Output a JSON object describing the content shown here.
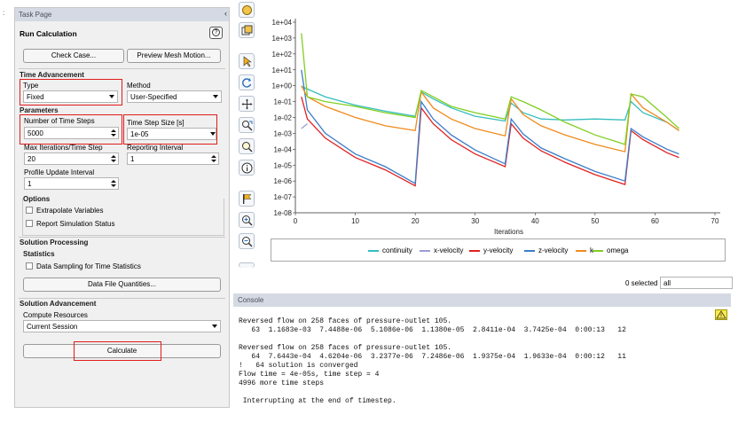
{
  "task_page": {
    "header": "Task Page",
    "title": "Run Calculation",
    "help_glyph": "?",
    "check_case_label": "Check Case...",
    "preview_mesh_label": "Preview Mesh Motion...",
    "time_advancement_label": "Time Advancement",
    "type_label": "Type",
    "type_value": "Fixed",
    "method_label": "Method",
    "method_value": "User-Specified",
    "parameters_label": "Parameters",
    "num_steps_label": "Number of Time Steps",
    "num_steps_value": "5000",
    "step_size_label": "Time Step Size [s]",
    "step_size_value": "1e-05",
    "max_iter_label": "Max Iterations/Time Step",
    "max_iter_value": "20",
    "reporting_label": "Reporting Interval",
    "reporting_value": "1",
    "profile_label": "Profile Update Interval",
    "profile_value": "1",
    "options_label": "Options",
    "extrapolate_label": "Extrapolate Variables",
    "report_status_label": "Report Simulation Status",
    "solution_processing_label": "Solution Processing",
    "statistics_label": "Statistics",
    "data_sampling_label": "Data Sampling for Time Statistics",
    "data_file_label": "Data File Quantities...",
    "solution_advancement_label": "Solution Advancement",
    "compute_resources_label": "Compute Resources",
    "compute_value": "Current Session",
    "calculate_label": "Calculate"
  },
  "chart_data": {
    "type": "line",
    "xlabel": "Iterations",
    "ylabel": "",
    "title": "",
    "xlim": [
      0,
      70
    ],
    "yscale": "log",
    "ylim": [
      1e-08,
      10000
    ],
    "x_ticks": [
      "0",
      "10",
      "20",
      "30",
      "40",
      "50",
      "60",
      "70"
    ],
    "y_ticks": [
      "1e-08",
      "1e-07",
      "1e-06",
      "1e-05",
      "1e-04",
      "1e-03",
      "1e-02",
      "1e-01",
      "1e+00",
      "1e+01",
      "1e+02",
      "1e+03",
      "1e+04"
    ],
    "series": [
      {
        "name": "continuity",
        "color": "#35bdbd",
        "x": [
          1,
          5,
          10,
          15,
          20,
          21,
          23,
          26,
          30,
          35,
          36,
          38,
          41,
          45,
          50,
          55,
          56,
          58,
          62,
          64
        ],
        "y": [
          0.9,
          0.2,
          0.06,
          0.025,
          0.012,
          0.4,
          0.15,
          0.04,
          0.012,
          0.006,
          0.08,
          0.02,
          0.008,
          0.007,
          0.008,
          0.007,
          0.1,
          0.02,
          0.005,
          0.0015
        ]
      },
      {
        "name": "x-velocity",
        "color": "#9b9bd6",
        "x": [
          1,
          2
        ],
        "y": [
          0.002,
          0.004
        ]
      },
      {
        "name": "y-velocity",
        "color": "#e02020",
        "x": [
          1,
          2,
          5,
          10,
          15,
          20,
          21,
          23,
          26,
          30,
          35,
          36,
          38,
          41,
          45,
          50,
          55,
          56,
          58,
          62,
          64
        ],
        "y": [
          0.2,
          0.008,
          0.0005,
          3e-05,
          5e-06,
          5e-07,
          0.04,
          0.004,
          0.0004,
          5e-05,
          8e-06,
          0.004,
          0.0005,
          8e-05,
          1.5e-05,
          2.5e-06,
          6e-07,
          0.0015,
          0.0004,
          6e-05,
          3e-05
        ]
      },
      {
        "name": "z-velocity",
        "color": "#3a7dc9",
        "x": [
          1,
          2,
          5,
          10,
          15,
          20,
          21,
          23,
          26,
          30,
          35,
          36,
          38,
          41,
          45,
          50,
          55,
          56,
          58,
          62,
          64
        ],
        "y": [
          10,
          0.03,
          0.001,
          5e-05,
          8e-06,
          7e-07,
          0.1,
          0.008,
          0.0008,
          9e-05,
          1.2e-05,
          0.008,
          0.0009,
          0.00012,
          2.5e-05,
          4e-06,
          1e-06,
          0.002,
          0.0006,
          0.0001,
          5e-05
        ]
      },
      {
        "name": "k",
        "color": "#f08a1c",
        "x": [
          1,
          2,
          5,
          10,
          15,
          20,
          21,
          23,
          26,
          30,
          35,
          36,
          38,
          41,
          45,
          50,
          55,
          56,
          58,
          62,
          64
        ],
        "y": [
          1.0,
          0.2,
          0.05,
          0.01,
          0.003,
          0.0015,
          0.4,
          0.04,
          0.008,
          0.002,
          0.0007,
          0.15,
          0.015,
          0.003,
          0.0008,
          0.0002,
          7e-05,
          0.3,
          0.04,
          0.005,
          0.0015
        ]
      },
      {
        "name": "omega",
        "color": "#7fcf1f",
        "x": [
          1,
          2,
          5,
          10,
          15,
          20,
          21,
          23,
          26,
          30,
          35,
          36,
          38,
          41,
          45,
          50,
          55,
          56,
          58,
          62,
          64
        ],
        "y": [
          2000,
          0.2,
          0.1,
          0.05,
          0.02,
          0.01,
          0.5,
          0.2,
          0.05,
          0.02,
          0.008,
          0.2,
          0.1,
          0.03,
          0.005,
          0.0008,
          0.0002,
          0.3,
          0.2,
          0.01,
          0.002
        ]
      }
    ]
  },
  "selection": {
    "count_text": "0 selected",
    "filter_value": "all"
  },
  "console": {
    "title": "Console",
    "lines": [
      "Reversed flow on 258 faces of pressure-outlet 105.",
      "   63  1.1683e-03  7.4488e-06  5.1086e-06  1.1380e-05  2.8411e-04  3.7425e-04  0:00:13   12",
      "",
      "Reversed flow on 258 faces of pressure-outlet 105.",
      "   64  7.6443e-04  4.6204e-06  3.2377e-06  7.2486e-06  1.9375e-04  1.9633e-04  0:00:12   11",
      "!   64 solution is converged",
      "Flow time = 4e-05s, time step = 4",
      "4996 more time steps",
      "",
      " Interrupting at the end of timestep."
    ]
  }
}
